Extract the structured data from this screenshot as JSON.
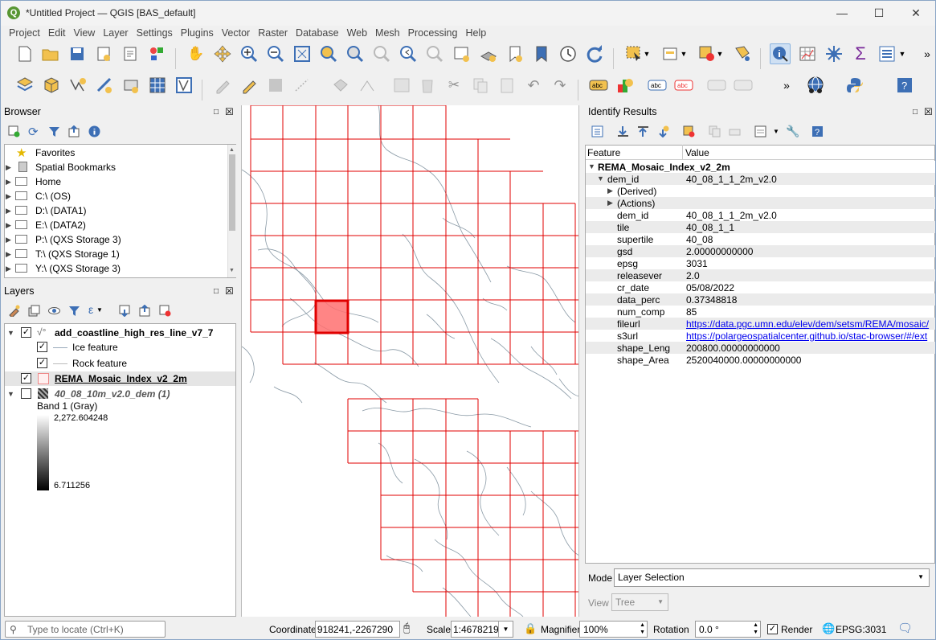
{
  "window": {
    "title": "*Untitled Project — QGIS [BAS_default]"
  },
  "menu": [
    "Project",
    "Edit",
    "View",
    "Layer",
    "Settings",
    "Plugins",
    "Vector",
    "Raster",
    "Database",
    "Web",
    "Mesh",
    "Processing",
    "Help"
  ],
  "browser": {
    "title": "Browser",
    "items": [
      {
        "label": "Favorites",
        "icon": "star-icon"
      },
      {
        "label": "Spatial Bookmarks",
        "icon": "bookmark-icon"
      },
      {
        "label": "Home",
        "icon": "folder-icon"
      },
      {
        "label": "C:\\ (OS)",
        "icon": "folder-icon"
      },
      {
        "label": "D:\\ (DATA1)",
        "icon": "folder-icon"
      },
      {
        "label": "E:\\ (DATA2)",
        "icon": "folder-icon"
      },
      {
        "label": "P:\\ (QXS Storage 3)",
        "icon": "folder-icon"
      },
      {
        "label": "T:\\ (QXS Storage 1)",
        "icon": "folder-icon"
      },
      {
        "label": "Y:\\ (QXS Storage 3)",
        "icon": "folder-icon"
      }
    ]
  },
  "layers": {
    "title": "Layers",
    "coastline": "add_coastline_high_res_line_v7_7",
    "ice": "Ice feature",
    "rock": "Rock feature",
    "rema": "REMA_Mosaic_Index_v2_2m",
    "dem": "40_08_10m_v2.0_dem (1)",
    "band": "Band 1 (Gray)",
    "max": "2,272.604248",
    "min": "6.711256"
  },
  "identify": {
    "title": "Identify Results",
    "col_feature": "Feature",
    "col_value": "Value",
    "layer": "REMA_Mosaic_Index_v2_2m",
    "root_key": "dem_id",
    "root_val": "40_08_1_1_2m_v2.0",
    "derived": "(Derived)",
    "actions": "(Actions)",
    "attrs": [
      {
        "k": "dem_id",
        "v": "40_08_1_1_2m_v2.0"
      },
      {
        "k": "tile",
        "v": "40_08_1_1"
      },
      {
        "k": "supertile",
        "v": "40_08"
      },
      {
        "k": "gsd",
        "v": "2.00000000000"
      },
      {
        "k": "epsg",
        "v": "3031"
      },
      {
        "k": "releasever",
        "v": "2.0"
      },
      {
        "k": "cr_date",
        "v": "05/08/2022"
      },
      {
        "k": "data_perc",
        "v": "0.37348818"
      },
      {
        "k": "num_comp",
        "v": "85"
      },
      {
        "k": "fileurl",
        "v": "https://data.pgc.umn.edu/elev/dem/setsm/REMA/mosaic/"
      },
      {
        "k": "s3url",
        "v": "https://polargeospatialcenter.github.io/stac-browser/#/ext"
      },
      {
        "k": "shape_Leng",
        "v": "200800.00000000000"
      },
      {
        "k": "shape_Area",
        "v": "2520040000.00000000000"
      }
    ],
    "mode_label": "Mode",
    "mode_value": "Layer Selection",
    "view_label": "View",
    "view_value": "Tree"
  },
  "status": {
    "locate_placeholder": "Type to locate (Ctrl+K)",
    "coord_label": "Coordinate",
    "coord_value": "918241,-2267290",
    "scale_label": "Scale",
    "scale_value": "1:4678219",
    "magnifier_label": "Magnifier",
    "magnifier_value": "100%",
    "rotation_label": "Rotation",
    "rotation_value": "0.0 °",
    "render_label": "Render",
    "crs": "EPSG:3031"
  },
  "colors": {
    "accent": "#589632",
    "grid": "#e00000",
    "selected": "#ff6a6a"
  }
}
